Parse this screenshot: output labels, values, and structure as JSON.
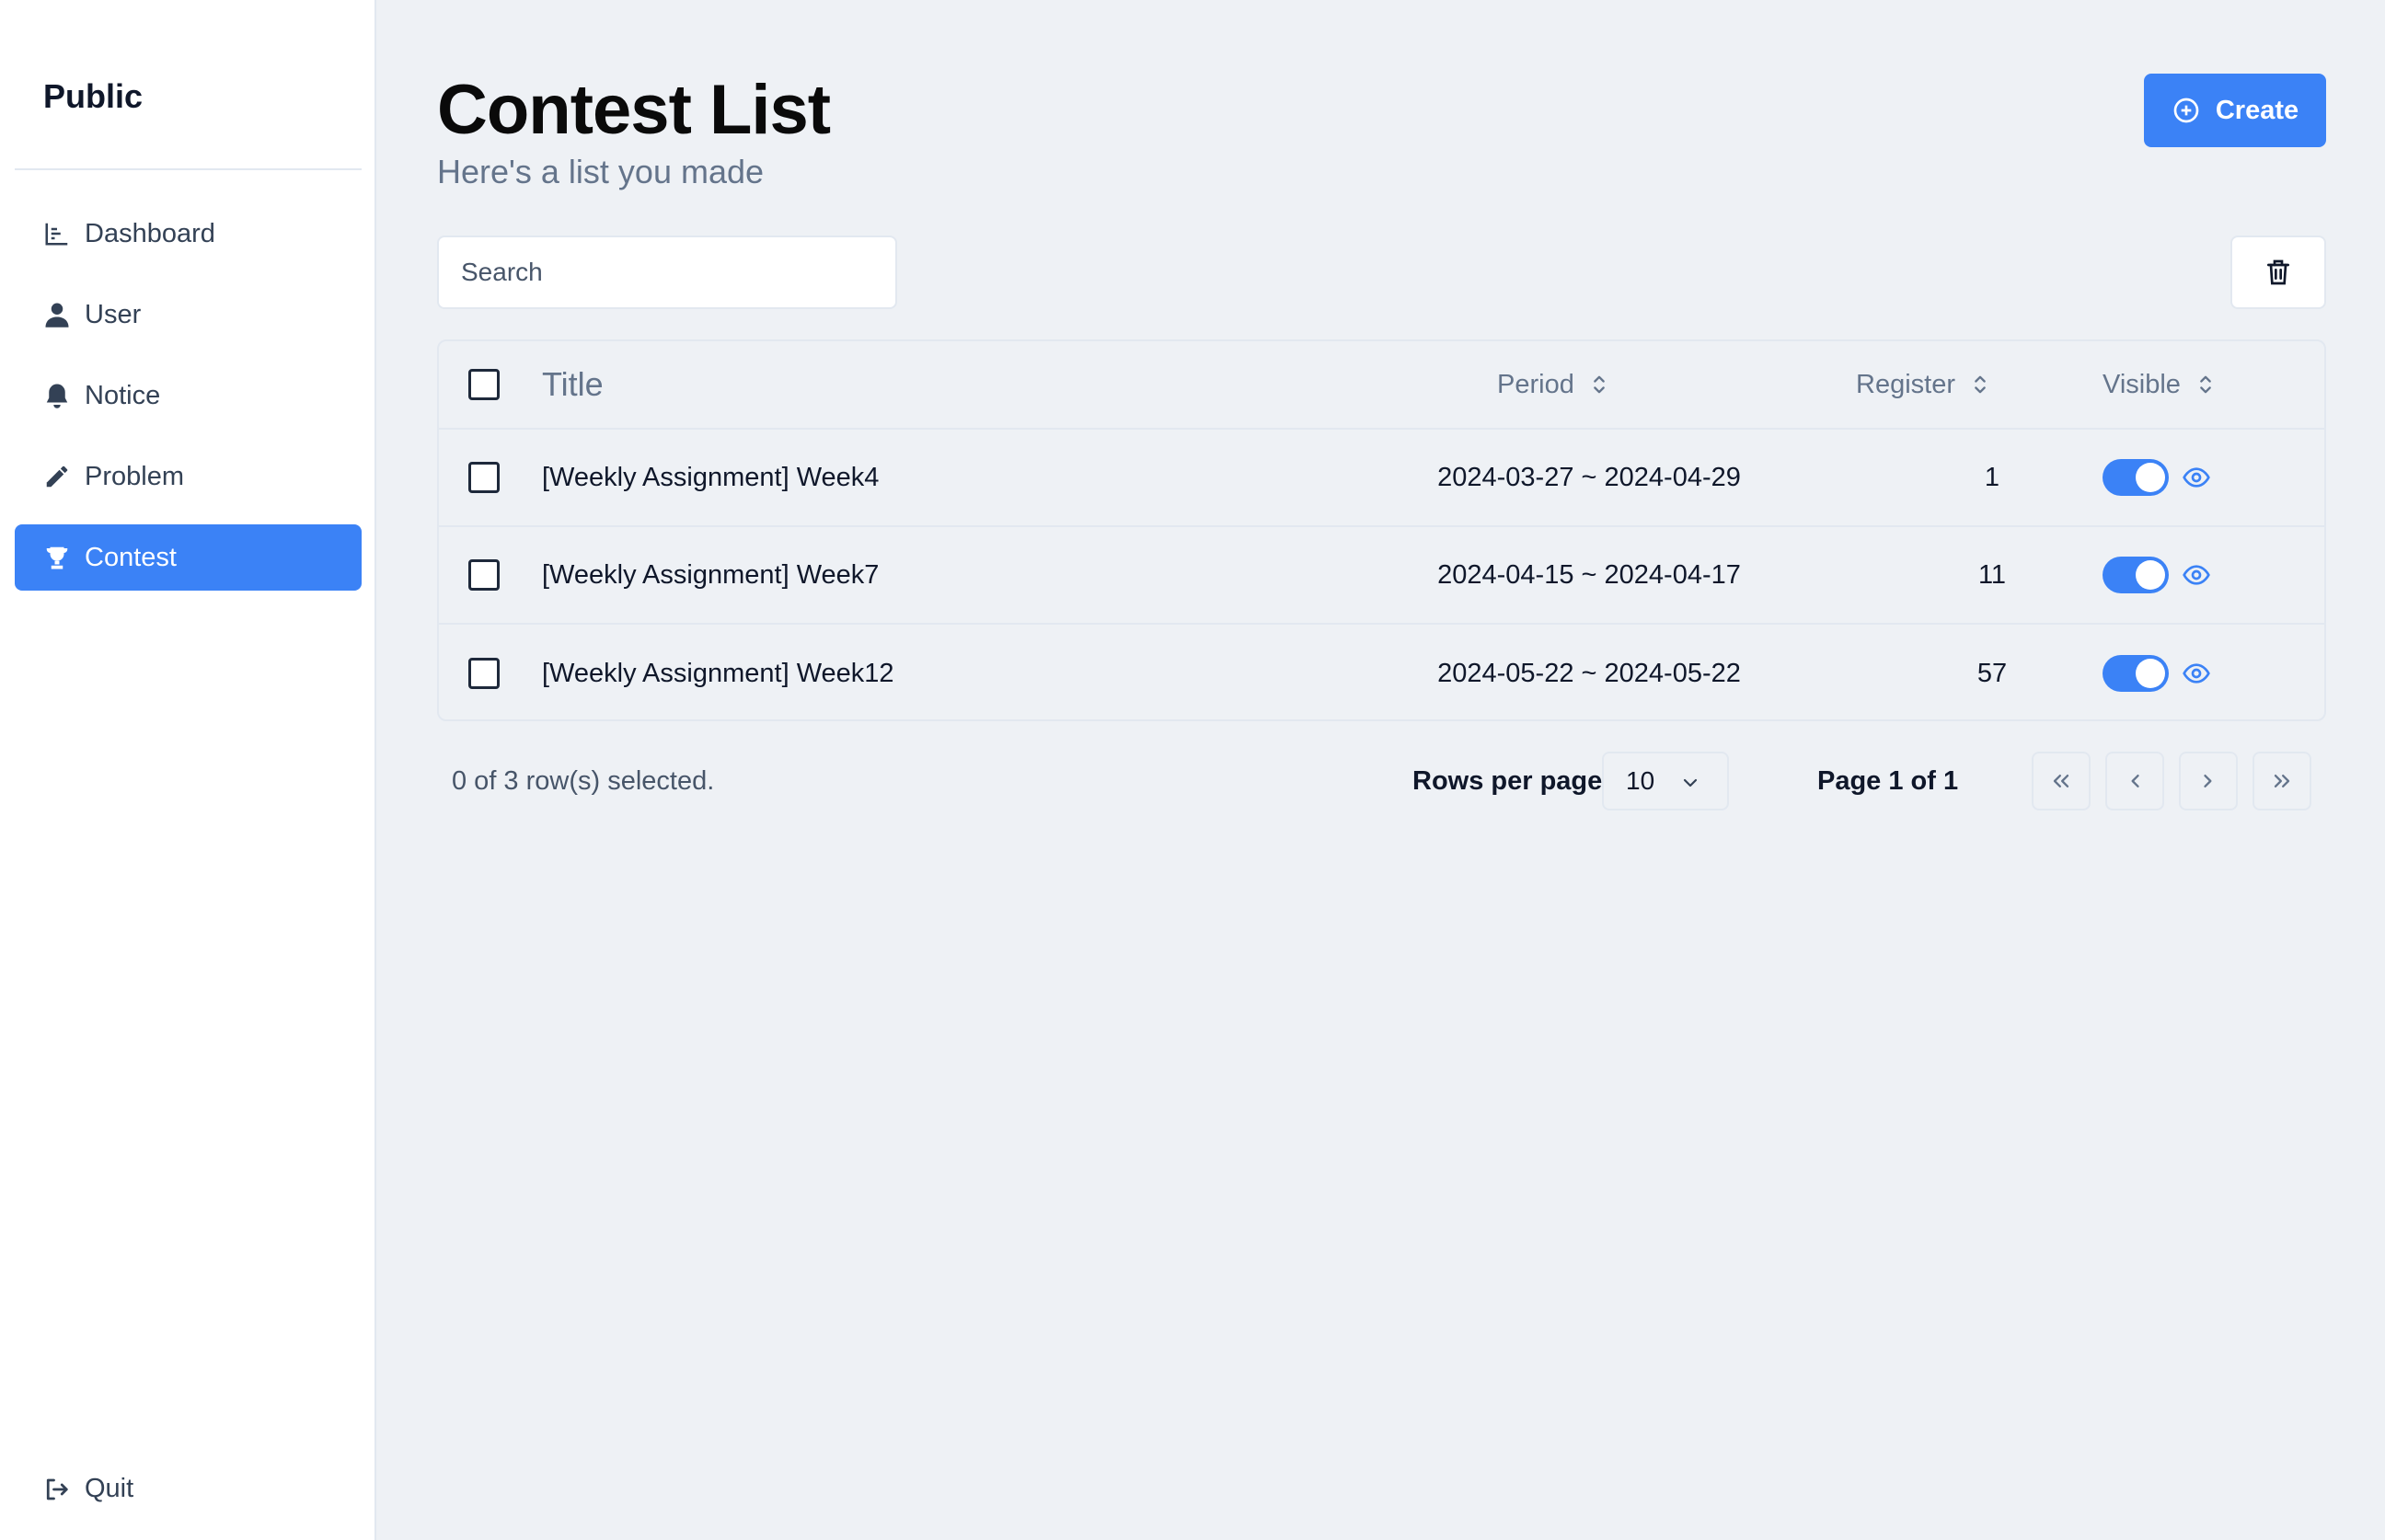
{
  "sidebar": {
    "brand": "Public",
    "items": [
      {
        "label": "Dashboard",
        "icon": "chart-bar-icon",
        "active": false
      },
      {
        "label": "User",
        "icon": "user-icon",
        "active": false
      },
      {
        "label": "Notice",
        "icon": "bell-icon",
        "active": false
      },
      {
        "label": "Problem",
        "icon": "pencil-icon",
        "active": false
      },
      {
        "label": "Contest",
        "icon": "trophy-icon",
        "active": true
      }
    ],
    "quit_label": "Quit"
  },
  "header": {
    "title": "Contest List",
    "subtitle": "Here's a list you made",
    "create_label": "Create"
  },
  "toolbar": {
    "search_placeholder": "Search",
    "search_value": ""
  },
  "table": {
    "columns": {
      "title": "Title",
      "period": "Period",
      "register": "Register",
      "visible": "Visible"
    },
    "rows": [
      {
        "title": "[Weekly Assignment] Week4",
        "period": "2024-03-27 ~ 2024-04-29",
        "register": "1",
        "visible": true
      },
      {
        "title": "[Weekly Assignment] Week7",
        "period": "2024-04-15 ~ 2024-04-17",
        "register": "11",
        "visible": true
      },
      {
        "title": "[Weekly Assignment] Week12",
        "period": "2024-05-22 ~ 2024-05-22",
        "register": "57",
        "visible": true
      }
    ]
  },
  "footer": {
    "selected_text": "0 of 3 row(s) selected.",
    "rows_per_page_label": "Rows per page",
    "rows_per_page_value": "10",
    "page_label": "Page 1 of 1"
  },
  "colors": {
    "accent": "#3b82f6",
    "background": "#eef1f5",
    "sidebar": "#ffffff"
  }
}
